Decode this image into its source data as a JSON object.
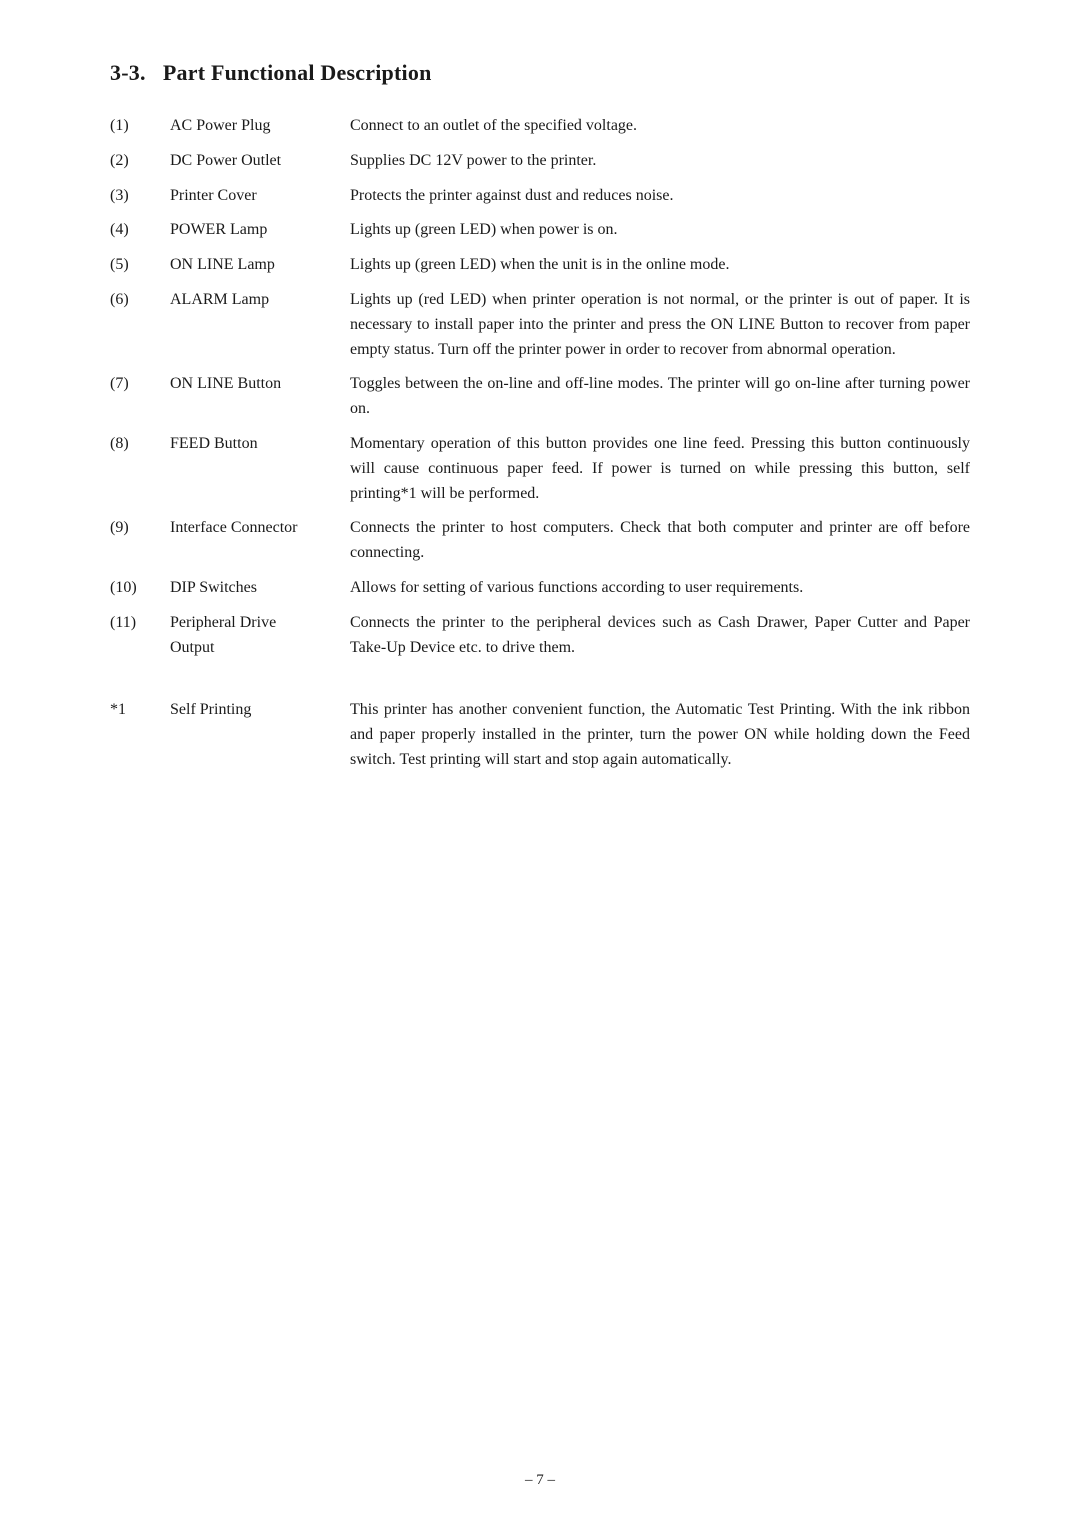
{
  "page": {
    "section_title": "3-3.   Part Functional Description",
    "items": [
      {
        "num": "(1)",
        "name": "AC Power Plug",
        "desc": "Connect to an outlet of the specified voltage."
      },
      {
        "num": "(2)",
        "name": "DC Power Outlet",
        "desc": "Supplies DC 12V power to the printer."
      },
      {
        "num": "(3)",
        "name": "Printer Cover",
        "desc": "Protects the printer against dust and reduces noise."
      },
      {
        "num": "(4)",
        "name": "POWER Lamp",
        "desc": "Lights up (green LED) when power is on."
      },
      {
        "num": "(5)",
        "name": "ON LINE Lamp",
        "desc": "Lights up (green LED) when the unit is in the online mode."
      },
      {
        "num": "(6)",
        "name": "ALARM Lamp",
        "desc": "Lights up (red LED) when printer operation is not normal, or the printer is out of paper. It is necessary to install paper into the printer and press the ON LINE Button to recover from paper empty status. Turn off the printer power in order to recover from abnormal operation."
      },
      {
        "num": "(7)",
        "name": "ON LINE Button",
        "desc": "Toggles between the on-line and off-line modes. The printer will go on-line after turning power on."
      },
      {
        "num": "(8)",
        "name": "FEED Button",
        "desc": "Momentary operation of this button provides one line feed. Pressing this button continuously will cause continuous paper feed. If power is turned on while pressing this button, self printing*1 will be performed."
      },
      {
        "num": "(9)",
        "name": "Interface Connector",
        "desc": "Connects the printer to host computers. Check that both computer and printer are off before connecting."
      },
      {
        "num": "(10)",
        "name": "DIP Switches",
        "desc": "Allows for setting of various functions according to user requirements."
      },
      {
        "num": "(11)",
        "name_line1": "Peripheral Drive",
        "name_line2": "Output",
        "multiline_name": true,
        "desc": "Connects the printer to the peripheral devices such as Cash Drawer, Paper Cutter and Paper Take-Up Device etc. to drive them."
      }
    ],
    "footnote": {
      "num": "*1",
      "label": "Self Printing",
      "desc": "This printer has another convenient function, the Automatic Test Printing. With the ink ribbon and paper properly installed in the printer, turn the power ON while holding down the Feed switch. Test printing will start and stop again automatically."
    },
    "footer": "– 7 –"
  }
}
